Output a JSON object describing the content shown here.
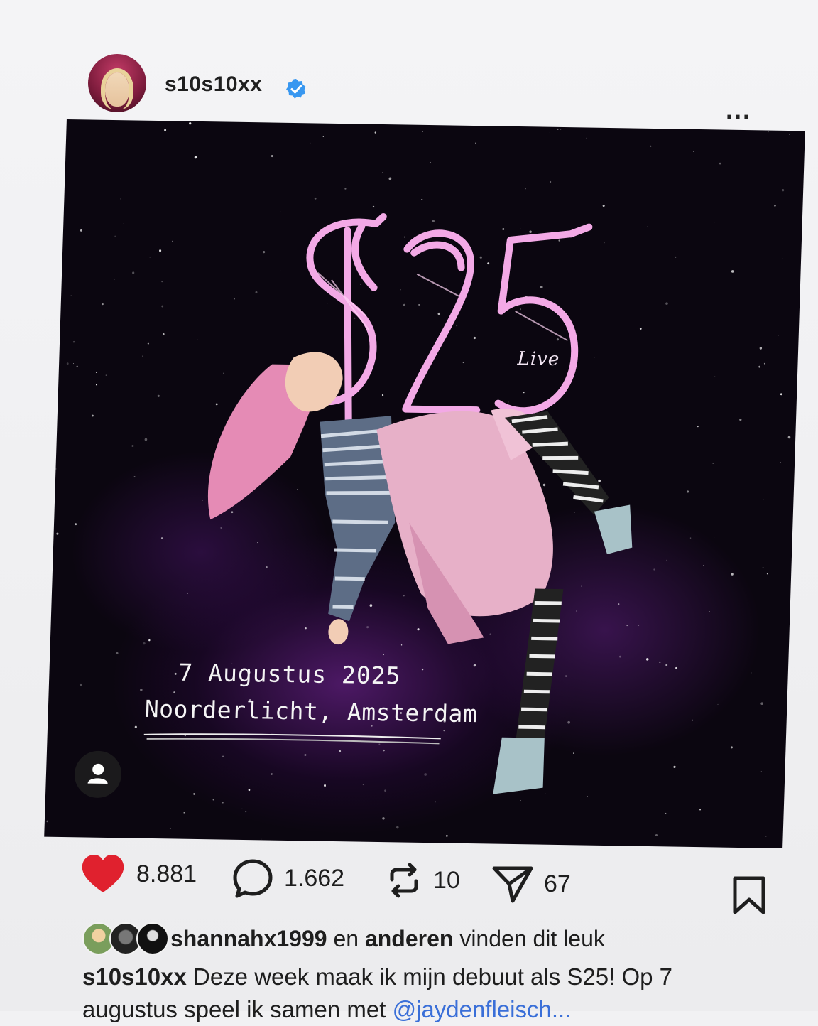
{
  "header": {
    "username": "s10s10xx",
    "verified_icon": "verified-badge-icon",
    "more_label": "..."
  },
  "post": {
    "logo_text": "S25",
    "logo_subtitle": "Live",
    "date_text": "7 Augustus 2025",
    "venue_text": "Noorderlicht, Amsterdam",
    "tag_icon": "person-tag-icon",
    "colors": {
      "background": "#0b0610",
      "nebula": "#8228aa",
      "logo": "#f3a9e6"
    }
  },
  "actions": {
    "likes": "8.881",
    "comments": "1.662",
    "reposts": "10",
    "shares": "67",
    "like_color": "#e0212e"
  },
  "likes_line": {
    "user": "shannahx1999",
    "connector": " en ",
    "others": "anderen",
    "suffix": " vinden dit leuk"
  },
  "caption": {
    "user": "s10s10xx",
    "text_line1": " Deze week maak ik mijn debuut als S25! Op 7",
    "text_line2": "augustus speel ik samen met ",
    "mention": "@jaydenfleisch..."
  }
}
